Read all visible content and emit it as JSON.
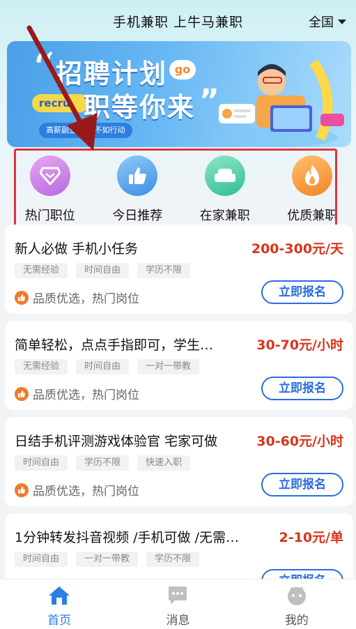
{
  "header": {
    "title": "手机兼职 上牛马兼职",
    "region": "全国"
  },
  "banner": {
    "headline_line1": "招聘计划",
    "headline_line2": "职等你来",
    "quote_open": "“",
    "quote_close": "”",
    "bubble": "go",
    "tag": "recru",
    "slogan": "高薪副业 心动不如行动"
  },
  "categories": [
    {
      "label": "热门职位",
      "icon": "diamond-icon",
      "color_from": "#e9a6f2",
      "color_to": "#b56ae0"
    },
    {
      "label": "今日推荐",
      "icon": "thumbs-up-icon",
      "color_from": "#8fc8f7",
      "color_to": "#3e8fe6"
    },
    {
      "label": "在家兼职",
      "icon": "sofa-icon",
      "color_from": "#8ee6c7",
      "color_to": "#2fbf94"
    },
    {
      "label": "优质兼职",
      "icon": "flame-icon",
      "color_from": "#ffc06a",
      "color_to": "#f2862a"
    }
  ],
  "jobs": [
    {
      "title": "新人必做 手机小任务",
      "salary": "200-300元/天",
      "tags": [
        "无需经验",
        "时间自由",
        "学历不限"
      ],
      "quality": "品质优选，热门岗位",
      "apply": "立即报名"
    },
    {
      "title": "简单轻松，点点手指即可，学生…",
      "salary": "30-70元/小时",
      "tags": [
        "无需经验",
        "时间自由",
        "一对一带教"
      ],
      "quality": "品质优选，热门岗位",
      "apply": "立即报名"
    },
    {
      "title": "日结手机评测游戏体验官 宅家可做",
      "salary": "30-60元/小时",
      "tags": [
        "时间自由",
        "学历不限",
        "快速入职"
      ],
      "quality": "品质优选，热门岗位",
      "apply": "立即报名"
    },
    {
      "title": "1分钟转发抖音视频 /手机可做 /无需…",
      "salary": "2-10元/单",
      "tags": [
        "时间自由",
        "一对一带教",
        "学历不限"
      ],
      "quality": "",
      "apply": "立即报名"
    }
  ],
  "tabbar": [
    {
      "label": "首页",
      "icon": "home-icon",
      "active": true
    },
    {
      "label": "消息",
      "icon": "message-icon",
      "active": false
    },
    {
      "label": "我的",
      "icon": "profile-icon",
      "active": false
    }
  ],
  "colors": {
    "accent": "#2a7fe0",
    "salary": "#d8341e",
    "highlight_box": "#e0343c"
  }
}
